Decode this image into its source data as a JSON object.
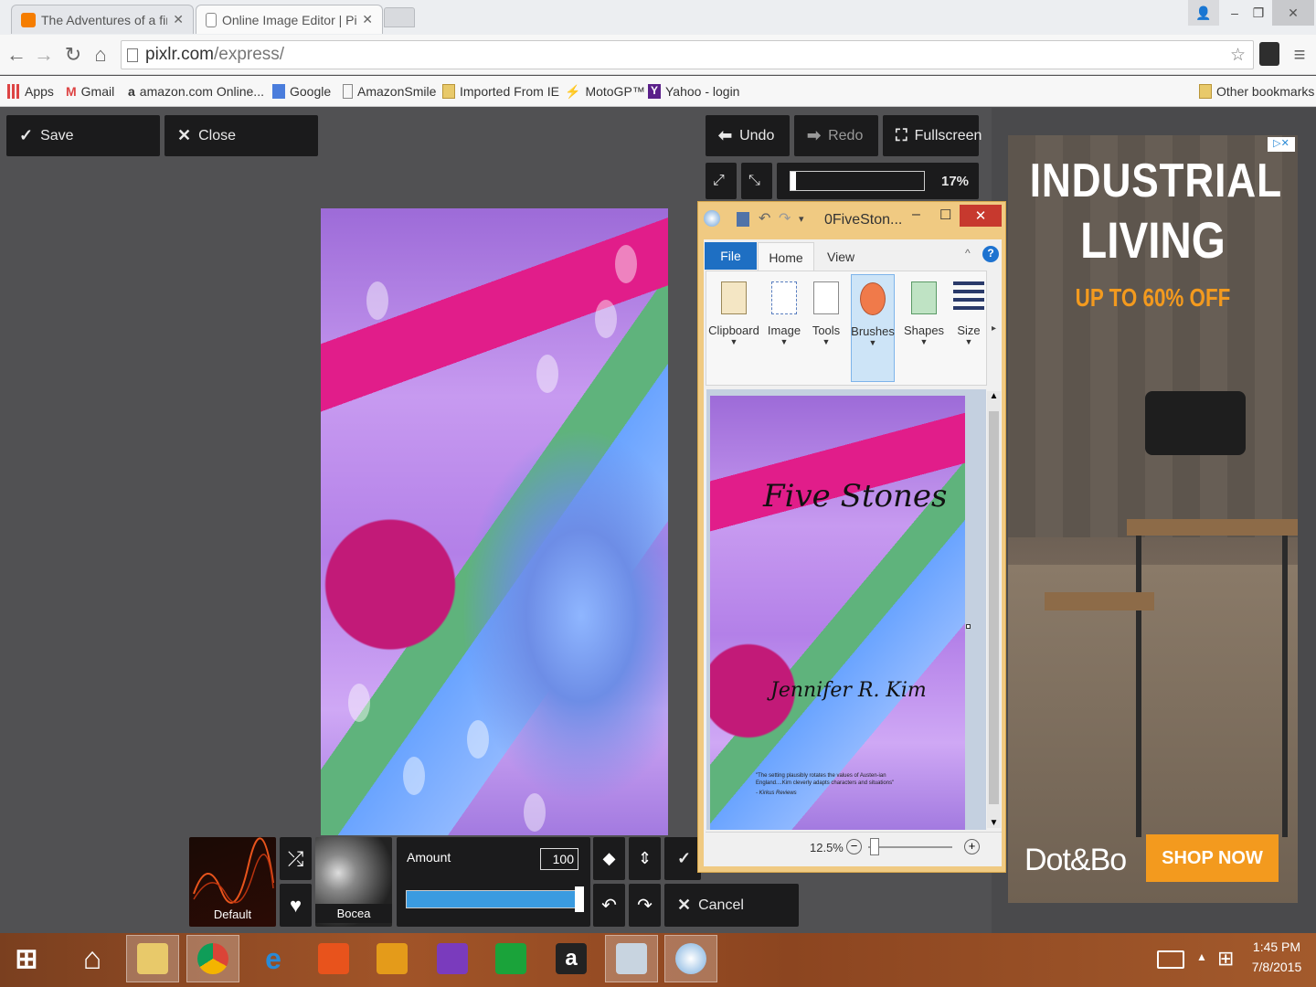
{
  "browser": {
    "tabs": [
      {
        "label": "The Adventures of a first t",
        "favicon": "blogger-icon"
      },
      {
        "label": "Online Image Editor | Pixlr",
        "favicon": "page-icon"
      }
    ],
    "url_host": "pixlr.com",
    "url_path": "/express/",
    "bookmarks": [
      {
        "label": "Apps"
      },
      {
        "label": "Gmail"
      },
      {
        "label": "amazon.com Online..."
      },
      {
        "label": "Google"
      },
      {
        "label": "AmazonSmile"
      },
      {
        "label": "Imported From IE"
      },
      {
        "label": "MotoGP™"
      },
      {
        "label": "Yahoo - login"
      }
    ],
    "other_bookmarks": "Other bookmarks"
  },
  "pixlr": {
    "save": "Save",
    "close": "Close",
    "undo": "Undo",
    "redo": "Redo",
    "fullscreen": "Fullscreen",
    "zoom": "17%",
    "filters": {
      "default_label": "Default",
      "bocea_label": "Bocea",
      "amount_label": "Amount",
      "amount_value": "100",
      "amount_level": 1.0,
      "apply_partial": "A",
      "cancel": "Cancel"
    }
  },
  "paint": {
    "title": "0FiveSton...",
    "tabs": {
      "file": "File",
      "home": "Home",
      "view": "View"
    },
    "ribbon": [
      "Clipboard",
      "Image",
      "Tools",
      "Brushes",
      "Shapes",
      "Size"
    ],
    "zoom": "12.5%",
    "cover": {
      "title": "Five Stones",
      "author": "Jennifer R. Kim",
      "quote": "\"The setting plausibly rotates the values of Austen-ian England....Kim cleverly adapts characters and situations\"",
      "source": "- Kirkus Reviews"
    }
  },
  "ad": {
    "headline1": "INDUSTRIAL",
    "headline2": "LIVING",
    "offer": "UP TO 60% OFF",
    "brand": "Dot&Bo",
    "cta": "SHOP NOW"
  },
  "taskbar": {
    "time": "1:45 PM",
    "date": "7/8/2015"
  },
  "colors": {
    "pixlr_bg": "#515153",
    "paint_accent": "#f0ca82",
    "ad_orange": "#f39a1e",
    "slider_blue": "#3a9be0"
  }
}
